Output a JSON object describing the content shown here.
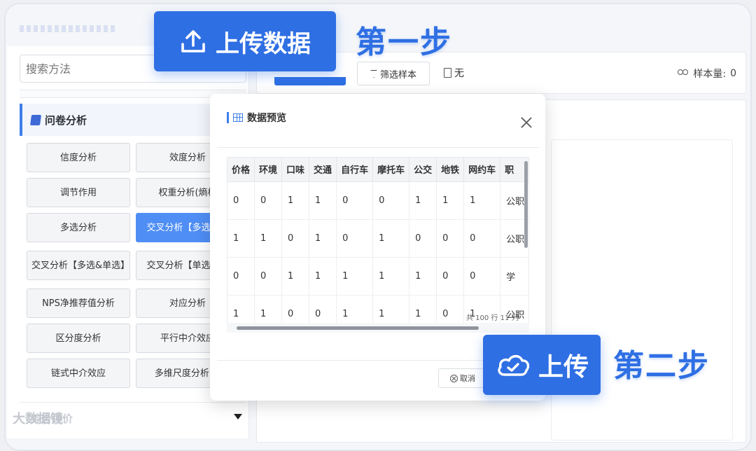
{
  "search": {
    "placeholder": "搜索方法"
  },
  "section_title": "问卷分析",
  "section2_title": "综合评价",
  "methods": [
    "信度分析",
    "效度分析",
    "调节作用",
    "权重分析(熵权",
    "多选分析",
    "交叉分析【多选选】",
    "交叉分析【多选&单选】",
    "交叉分析【单选选】",
    "NPS净推荐值分析",
    "对应分析",
    "区分度分析",
    "平行中介效应",
    "链式中介效应",
    "多维尺度分析(M"
  ],
  "toolbar": {
    "filter_label": "筛选样本",
    "doc_label": "无",
    "sample_label": "样本量:",
    "sample_value": "0"
  },
  "modal": {
    "title": "数据预览",
    "headers": [
      "价格",
      "环境",
      "口味",
      "交通",
      "自行车",
      "摩托车",
      "公交",
      "地铁",
      "网约车",
      "职"
    ],
    "rows": [
      [
        "0",
        "0",
        "1",
        "1",
        "0",
        "0",
        "1",
        "1",
        "1",
        "公职"
      ],
      [
        "1",
        "1",
        "0",
        "1",
        "0",
        "1",
        "0",
        "0",
        "0",
        "公职"
      ],
      [
        "0",
        "0",
        "1",
        "1",
        "1",
        "1",
        "1",
        "0",
        "0",
        "学"
      ],
      [
        "1",
        "1",
        "0",
        "0",
        "1",
        "1",
        "1",
        "0",
        "1",
        "公职"
      ]
    ],
    "row_count": "共 100 行 11 列",
    "cancel_label": "取消"
  },
  "overlay": {
    "upload_data_label": "上传数据",
    "step1": "第一步",
    "upload_label": "上传",
    "step2": "第二步"
  },
  "watermark": "大数据镜"
}
